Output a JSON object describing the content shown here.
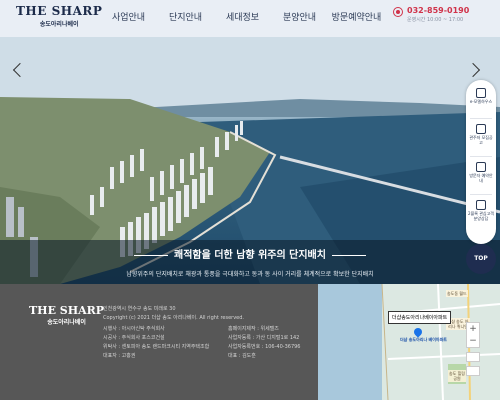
{
  "brand": {
    "logo_main": "THE SHARP",
    "logo_sub": "송도아리나베이"
  },
  "nav": [
    {
      "label": "사업안내"
    },
    {
      "label": "단지안내"
    },
    {
      "label": "세대정보"
    },
    {
      "label": "분양안내"
    },
    {
      "label": "방문예약안내"
    }
  ],
  "contact": {
    "phone": "032-859-0190",
    "hours": "운영시간 10:00 ~ 17:00"
  },
  "hero": {
    "title": "쾌적함을 더한 남향 위주의 단지배치",
    "desc": "남향위주의 단지배치로 채광과 통풍을 극대화하고 동과 동 사이 거리를 체계적으로 확보한 단지배치"
  },
  "quick_menu": [
    {
      "icon": "document-icon",
      "label": "e-모델하우스"
    },
    {
      "icon": "list-icon",
      "label": "관주저 모집공고"
    },
    {
      "icon": "house-icon",
      "label": "방문자 예약안내"
    },
    {
      "icon": "video-icon",
      "label": "2블록 관심고객 분양상담"
    }
  ],
  "top_button": "TOP",
  "footer": {
    "logo_main": "THE SHARP",
    "logo_sub": "송도아리나베이",
    "address": "인천광역시 연수구 송도 미래로 30",
    "copyright": "Copyright (c) 2021 더샵 송도 아리나베이. All right reserved.",
    "info_left": [
      "시행사 : 아시아신탁 주식회사",
      "시공사 : 주식회사 포스코건설",
      "위탁사 : 센토피아 송도 랜드마크시티 지역주택조합",
      "대표자 : 고홍권"
    ],
    "info_right": [
      "홈페이지제작 : 위세텔즈",
      "사업자등록 : 가산 디지털1로 142",
      "사업자등록번호 : 106-40-36796",
      "대표 : 김도훈"
    ]
  },
  "map": {
    "callout": "더샵송도아리나베이아파트",
    "pin_label": "더샵 송도아리나 베이아파트",
    "labels": [
      "송도동 월드",
      "더샵 송도 아리나 퀴니언",
      "송도 힐링 공원"
    ]
  },
  "colors": {
    "accent": "#d0334a",
    "navy": "#1f2d50",
    "footer_bg": "#575757"
  }
}
